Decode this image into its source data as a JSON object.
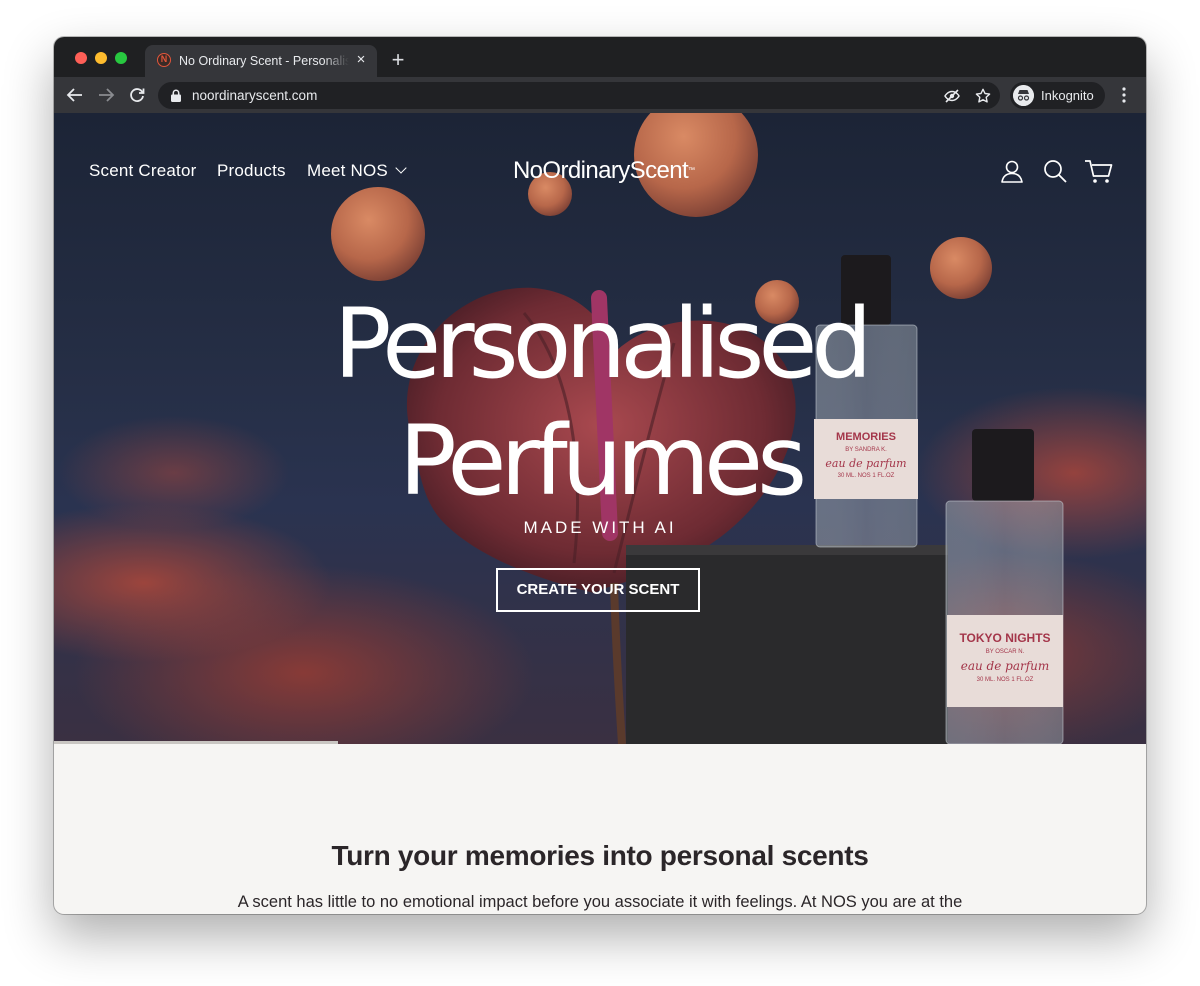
{
  "browser": {
    "tab_title": "No Ordinary Scent - Personalised Perfumes",
    "url": "noordinaryscent.com",
    "profile_label": "Inkognito"
  },
  "site": {
    "nav": [
      "Scent Creator",
      "Products",
      "Meet NOS"
    ],
    "logo": "NoOrdinaryScent",
    "logo_mark": "™"
  },
  "hero": {
    "headline_line1": "Personalised",
    "headline_line2": "Perfumes",
    "subheadline": "MADE WITH AI",
    "cta_label": "CREATE YOUR SCENT",
    "bottles": [
      {
        "name": "MEMORIES",
        "by": "BY SANDRA K.",
        "type": "eau de parfum",
        "size": "30 ML.",
        "badge": "NOS",
        "oz": "1 FL.OZ"
      },
      {
        "name": "TOKYO NIGHTS",
        "by": "BY OSCAR N.",
        "type": "eau de parfum",
        "size": "30 ML.",
        "badge": "NOS",
        "oz": "1 FL.OZ"
      }
    ]
  },
  "section": {
    "title": "Turn your memories into personal scents",
    "body": "A scent has little to no emotional impact before you associate it with feelings. At NOS you are at the"
  },
  "colors": {
    "tabstrip": "#1f2022",
    "toolbar": "#35363a",
    "hero_sky": "#252e45",
    "clouds": "#b04a3c",
    "page_bg": "#f6f5f3",
    "text_dark": "#2b2629"
  }
}
